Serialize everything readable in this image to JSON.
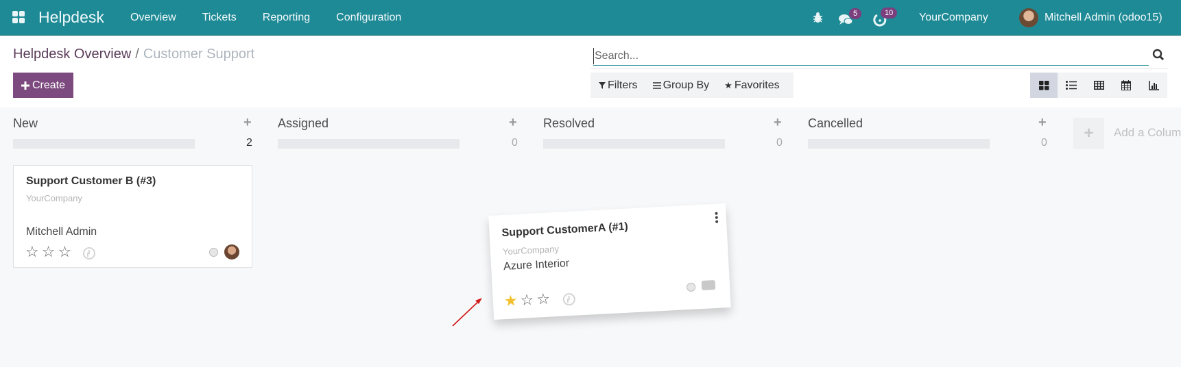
{
  "navbar": {
    "app_name": "Helpdesk",
    "menu": [
      "Overview",
      "Tickets",
      "Reporting",
      "Configuration"
    ],
    "icons": {
      "apps": "apps-grid-icon",
      "debug": "bug-icon",
      "messages": "chat-icon",
      "activities": "clock-icon"
    },
    "messages_count": "5",
    "activities_count": "10",
    "company": "YourCompany",
    "user": "Mitchell Admin (odoo15)"
  },
  "breadcrumb": {
    "parent": "Helpdesk Overview",
    "separator": "/",
    "current": "Customer Support"
  },
  "toolbar": {
    "create_label": "Create",
    "search_placeholder": "Search...",
    "filters_label": "Filters",
    "groupby_label": "Group By",
    "favorites_label": "Favorites",
    "views": [
      "kanban",
      "list",
      "pivot",
      "calendar",
      "graph"
    ],
    "active_view": "kanban"
  },
  "colors": {
    "navbar": "#1e8a96",
    "primary": "#7c4a7e",
    "star_filled": "#f3c02c",
    "arrow": "#d21f1f"
  },
  "kanban": {
    "columns": [
      {
        "name": "New",
        "count": "2"
      },
      {
        "name": "Assigned",
        "count": "0"
      },
      {
        "name": "Resolved",
        "count": "0"
      },
      {
        "name": "Cancelled",
        "count": "0"
      }
    ],
    "add_column_label": "Add a Column",
    "cards": [
      {
        "title": "Support Customer B (#3)",
        "company": "YourCompany",
        "partner": "Mitchell Admin",
        "priority": 0,
        "priority_max": 3
      },
      {
        "title": "Support CustomerA (#1)",
        "company": "YourCompany",
        "partner": "Azure Interior",
        "priority": 1,
        "priority_max": 3,
        "state": "dragging"
      }
    ]
  }
}
